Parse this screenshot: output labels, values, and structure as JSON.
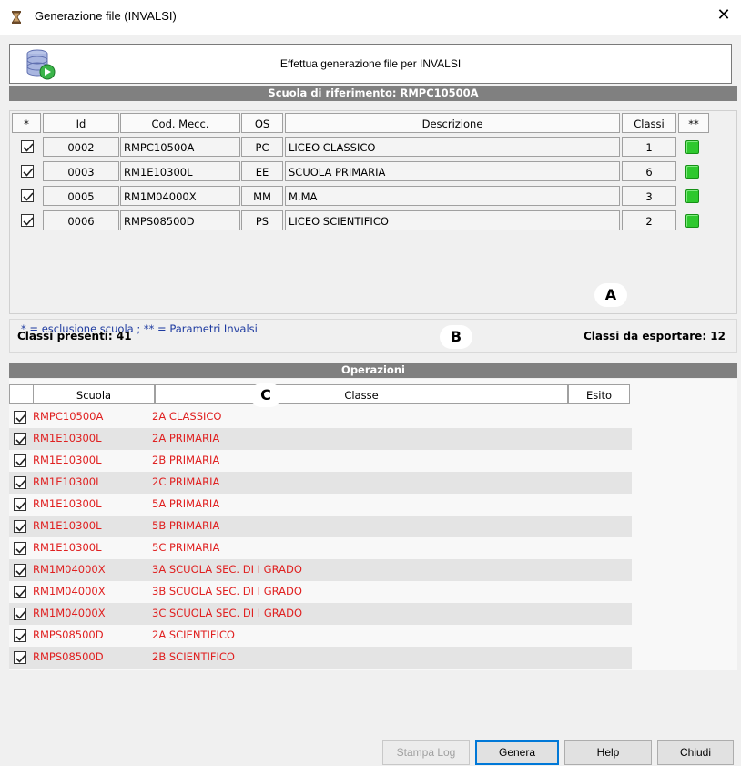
{
  "window": {
    "title": "Generazione file (INVALSI)",
    "close": "✕"
  },
  "header": {
    "text": "Effettua generazione file per INVALSI"
  },
  "school_band": "Scuola di riferimento: RMPC10500A",
  "schools_table": {
    "columns": [
      "*",
      "Id",
      "Cod. Mecc.",
      "OS",
      "Descrizione",
      "Classi",
      "**"
    ],
    "rows": [
      {
        "checked": true,
        "id": "0002",
        "cod": "RMPC10500A",
        "os": "PC",
        "desc": "LICEO CLASSICO",
        "classi": "1",
        "status_color": "#2ec82e"
      },
      {
        "checked": true,
        "id": "0003",
        "cod": "RM1E10300L",
        "os": "EE",
        "desc": "SCUOLA PRIMARIA",
        "classi": "6",
        "status_color": "#2ec82e"
      },
      {
        "checked": true,
        "id": "0005",
        "cod": "RM1M04000X",
        "os": "MM",
        "desc": "M.MA",
        "classi": "3",
        "status_color": "#2ec82e"
      },
      {
        "checked": true,
        "id": "0006",
        "cod": "RMPS08500D",
        "os": "PS",
        "desc": "LICEO SCIENTIFICO",
        "classi": "2",
        "status_color": "#2ec82e"
      }
    ]
  },
  "legend": "* = esclusione scuola ; ** = Parametri Invalsi",
  "markers": {
    "a": "A",
    "b": "B",
    "c": "C"
  },
  "summary": {
    "present": "Classi presenti: 41",
    "export": "Classi da esportare: 12"
  },
  "operations_band": "Operazioni",
  "operations_table": {
    "columns": [
      "Scuola",
      "Classe",
      "Esito"
    ],
    "rows": [
      {
        "checked": true,
        "scuola": "RMPC10500A",
        "classe": "2A CLASSICO"
      },
      {
        "checked": true,
        "scuola": "RM1E10300L",
        "classe": "2A PRIMARIA"
      },
      {
        "checked": true,
        "scuola": "RM1E10300L",
        "classe": "2B PRIMARIA"
      },
      {
        "checked": true,
        "scuola": "RM1E10300L",
        "classe": "2C PRIMARIA"
      },
      {
        "checked": true,
        "scuola": "RM1E10300L",
        "classe": "5A PRIMARIA"
      },
      {
        "checked": true,
        "scuola": "RM1E10300L",
        "classe": "5B PRIMARIA"
      },
      {
        "checked": true,
        "scuola": "RM1E10300L",
        "classe": "5C PRIMARIA"
      },
      {
        "checked": true,
        "scuola": "RM1M04000X",
        "classe": "3A SCUOLA SEC. DI I GRADO"
      },
      {
        "checked": true,
        "scuola": "RM1M04000X",
        "classe": "3B SCUOLA SEC. DI I GRADO"
      },
      {
        "checked": true,
        "scuola": "RM1M04000X",
        "classe": "3C SCUOLA SEC. DI I GRADO"
      },
      {
        "checked": true,
        "scuola": "RMPS08500D",
        "classe": "2A SCIENTIFICO"
      },
      {
        "checked": true,
        "scuola": "RMPS08500D",
        "classe": "2B SCIENTIFICO"
      }
    ]
  },
  "buttons": {
    "stampa_log": "Stampa Log",
    "genera": "Genera",
    "help": "Help",
    "chiudi": "Chiudi"
  },
  "colors": {
    "band": "#808080",
    "row_text": "#e02020",
    "legend_text": "#1d3aa0",
    "accent": "#0078d7"
  }
}
